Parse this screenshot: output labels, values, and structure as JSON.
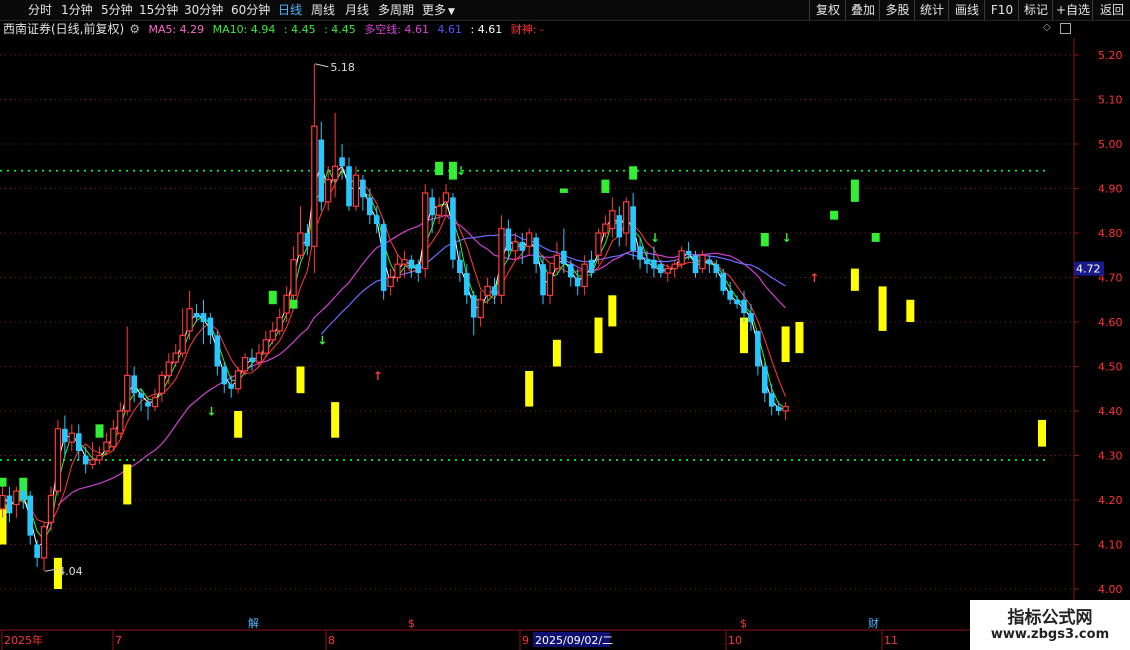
{
  "toolbar": {
    "period_tabs": [
      "分时",
      "1分钟",
      "5分钟",
      "15分钟",
      "30分钟",
      "60分钟",
      "日线",
      "周线",
      "月线",
      "多周期",
      "更多"
    ],
    "active_tab": "日线",
    "right_buttons": [
      "复权",
      "叠加",
      "多股",
      "统计",
      "画线",
      "F10",
      "标记",
      "+自选",
      "返回"
    ]
  },
  "info_bar": {
    "title": "西南证券(日线,前复权)",
    "ma5": "MA5: 4.29",
    "ma10": "MA10: 4.94",
    "v1": ": 4.45",
    "v2": ": 4.45",
    "duokong": "多空线: 4.61",
    "v3": "4.61",
    "v4": ": 4.61",
    "caishen": "财神: -"
  },
  "colors": {
    "up": "#ff3a3a",
    "down": "#29c7ff",
    "yellow": "#ffff00",
    "green": "#33ee33",
    "ma_white": "#ffffff",
    "ma_blue": "#6b6bff",
    "ma_magenta": "#d040d0",
    "grid": "#8b1414",
    "dotted_green": "#00ff44",
    "dotted_magenta": "#ff44ff"
  },
  "chart_data": {
    "type": "candlestick",
    "y_ticks": [
      "5.20",
      "5.10",
      "5.00",
      "4.90",
      "4.80",
      "4.70",
      "4.60",
      "4.50",
      "4.40",
      "4.30",
      "4.20",
      "4.10",
      "4.00"
    ],
    "ylim": [
      3.975,
      5.245
    ],
    "high_label": "5.18",
    "low_label": "4.04",
    "current_price": "4.72",
    "support_level": 4.29,
    "resistance_level": 4.94,
    "x_labels": [
      "2025年",
      "7",
      "8",
      "9",
      "10",
      "11"
    ],
    "date_highlight": "2025/09/02/二",
    "event_markers": [
      "解",
      "$",
      "$",
      "财"
    ],
    "candles": [
      [
        4.18,
        4.21,
        4.16,
        4.23
      ],
      [
        4.21,
        4.17,
        4.15,
        4.23
      ],
      [
        4.19,
        4.22,
        4.16,
        4.23
      ],
      [
        4.22,
        4.2,
        4.18,
        4.24
      ],
      [
        4.21,
        4.12,
        4.1,
        4.22
      ],
      [
        4.1,
        4.07,
        4.05,
        4.11
      ],
      [
        4.07,
        4.14,
        4.04,
        4.15
      ],
      [
        4.15,
        4.21,
        4.13,
        4.23
      ],
      [
        4.22,
        4.36,
        4.21,
        4.38
      ],
      [
        4.36,
        4.33,
        4.3,
        4.39
      ],
      [
        4.33,
        4.35,
        4.31,
        4.37
      ],
      [
        4.35,
        4.31,
        4.29,
        4.37
      ],
      [
        4.3,
        4.28,
        4.26,
        4.32
      ],
      [
        4.28,
        4.29,
        4.27,
        4.33
      ],
      [
        4.29,
        4.3,
        4.28,
        4.32
      ],
      [
        4.31,
        4.33,
        4.3,
        4.35
      ],
      [
        4.32,
        4.36,
        4.31,
        4.38
      ],
      [
        4.35,
        4.4,
        4.34,
        4.42
      ],
      [
        4.4,
        4.48,
        4.39,
        4.59
      ],
      [
        4.48,
        4.44,
        4.42,
        4.5
      ],
      [
        4.44,
        4.43,
        4.4,
        4.45
      ],
      [
        4.42,
        4.41,
        4.38,
        4.43
      ],
      [
        4.41,
        4.43,
        4.4,
        4.45
      ],
      [
        4.44,
        4.48,
        4.42,
        4.49
      ],
      [
        4.48,
        4.51,
        4.46,
        4.53
      ],
      [
        4.51,
        4.53,
        4.5,
        4.55
      ],
      [
        4.53,
        4.57,
        4.52,
        4.63
      ],
      [
        4.58,
        4.63,
        4.56,
        4.67
      ],
      [
        4.62,
        4.61,
        4.6,
        4.64
      ],
      [
        4.62,
        4.6,
        4.55,
        4.65
      ],
      [
        4.61,
        4.57,
        4.55,
        4.62
      ],
      [
        4.57,
        4.5,
        4.48,
        4.58
      ],
      [
        4.5,
        4.46,
        4.44,
        4.51
      ],
      [
        4.46,
        4.45,
        4.43,
        4.48
      ],
      [
        4.45,
        4.49,
        4.44,
        4.5
      ],
      [
        4.49,
        4.52,
        4.48,
        4.53
      ],
      [
        4.52,
        4.51,
        4.49,
        4.54
      ],
      [
        4.51,
        4.53,
        4.5,
        4.55
      ],
      [
        4.53,
        4.56,
        4.52,
        4.58
      ],
      [
        4.56,
        4.58,
        4.55,
        4.6
      ],
      [
        4.58,
        4.61,
        4.57,
        4.63
      ],
      [
        4.62,
        4.66,
        4.6,
        4.68
      ],
      [
        4.66,
        4.74,
        4.65,
        4.77
      ],
      [
        4.75,
        4.8,
        4.74,
        4.86
      ],
      [
        4.8,
        4.77,
        4.75,
        4.82
      ],
      [
        4.77,
        5.04,
        4.71,
        5.18
      ],
      [
        5.01,
        4.87,
        4.85,
        5.05
      ],
      [
        4.87,
        4.92,
        4.85,
        4.95
      ],
      [
        4.92,
        4.95,
        4.88,
        5.07
      ],
      [
        4.97,
        4.95,
        4.92,
        5.0
      ],
      [
        4.95,
        4.86,
        4.85,
        4.97
      ],
      [
        4.86,
        4.93,
        4.85,
        4.95
      ],
      [
        4.92,
        4.88,
        4.85,
        4.93
      ],
      [
        4.88,
        4.84,
        4.82,
        4.9
      ],
      [
        4.84,
        4.82,
        4.8,
        4.86
      ],
      [
        4.82,
        4.67,
        4.65,
        4.83
      ],
      [
        4.68,
        4.7,
        4.66,
        4.72
      ],
      [
        4.7,
        4.73,
        4.69,
        4.75
      ],
      [
        4.73,
        4.74,
        4.7,
        4.76
      ],
      [
        4.74,
        4.72,
        4.7,
        4.75
      ],
      [
        4.73,
        4.71,
        4.69,
        4.74
      ],
      [
        4.72,
        4.89,
        4.7,
        4.91
      ],
      [
        4.88,
        4.84,
        4.8,
        4.9
      ],
      [
        4.84,
        4.86,
        4.82,
        4.88
      ],
      [
        4.87,
        4.89,
        4.84,
        4.91
      ],
      [
        4.88,
        4.74,
        4.72,
        4.89
      ],
      [
        4.74,
        4.71,
        4.69,
        4.76
      ],
      [
        4.71,
        4.66,
        4.64,
        4.73
      ],
      [
        4.66,
        4.61,
        4.57,
        4.67
      ],
      [
        4.61,
        4.65,
        4.59,
        4.67
      ],
      [
        4.66,
        4.68,
        4.64,
        4.7
      ],
      [
        4.68,
        4.66,
        4.64,
        4.7
      ],
      [
        4.66,
        4.81,
        4.64,
        4.84
      ],
      [
        4.81,
        4.76,
        4.74,
        4.83
      ],
      [
        4.76,
        4.78,
        4.74,
        4.8
      ],
      [
        4.78,
        4.76,
        4.73,
        4.8
      ],
      [
        4.77,
        4.8,
        4.75,
        4.81
      ],
      [
        4.79,
        4.73,
        4.71,
        4.8
      ],
      [
        4.73,
        4.66,
        4.64,
        4.75
      ],
      [
        4.66,
        4.71,
        4.64,
        4.73
      ],
      [
        4.72,
        4.75,
        4.71,
        4.78
      ],
      [
        4.76,
        4.73,
        4.71,
        4.81
      ],
      [
        4.73,
        4.7,
        4.68,
        4.74
      ],
      [
        4.7,
        4.68,
        4.66,
        4.72
      ],
      [
        4.68,
        4.73,
        4.66,
        4.75
      ],
      [
        4.74,
        4.71,
        4.7,
        4.76
      ],
      [
        4.75,
        4.8,
        4.73,
        4.81
      ],
      [
        4.8,
        4.82,
        4.79,
        4.84
      ],
      [
        4.81,
        4.85,
        4.79,
        4.88
      ],
      [
        4.84,
        4.79,
        4.77,
        4.86
      ],
      [
        4.8,
        4.87,
        4.77,
        4.88
      ],
      [
        4.86,
        4.76,
        4.74,
        4.89
      ],
      [
        4.77,
        4.74,
        4.72,
        4.79
      ],
      [
        4.74,
        4.73,
        4.71,
        4.76
      ],
      [
        4.74,
        4.72,
        4.7,
        4.77
      ],
      [
        4.73,
        4.71,
        4.7,
        4.74
      ],
      [
        4.71,
        4.72,
        4.69,
        4.73
      ],
      [
        4.72,
        4.73,
        4.7,
        4.74
      ],
      [
        4.73,
        4.76,
        4.72,
        4.77
      ],
      [
        4.76,
        4.75,
        4.74,
        4.78
      ],
      [
        4.75,
        4.71,
        4.7,
        4.76
      ],
      [
        4.72,
        4.75,
        4.71,
        4.76
      ],
      [
        4.74,
        4.73,
        4.71,
        4.75
      ],
      [
        4.73,
        4.71,
        4.7,
        4.74
      ],
      [
        4.71,
        4.67,
        4.66,
        4.72
      ],
      [
        4.67,
        4.65,
        4.64,
        4.69
      ],
      [
        4.65,
        4.64,
        4.63,
        4.66
      ],
      [
        4.65,
        4.62,
        4.6,
        4.67
      ],
      [
        4.62,
        4.6,
        4.58,
        4.64
      ],
      [
        4.58,
        4.5,
        4.48,
        4.58
      ],
      [
        4.5,
        4.44,
        4.42,
        4.51
      ],
      [
        4.44,
        4.41,
        4.39,
        4.46
      ],
      [
        4.41,
        4.4,
        4.39,
        4.42
      ],
      [
        4.4,
        4.41,
        4.38,
        4.42
      ]
    ],
    "yellow_bars": [
      [
        0,
        4.1,
        4.19
      ],
      [
        8,
        4.0,
        4.07
      ],
      [
        18,
        4.19,
        4.28
      ],
      [
        34,
        4.34,
        4.4
      ],
      [
        43,
        4.44,
        4.5
      ],
      [
        48,
        4.34,
        4.42
      ],
      [
        76,
        4.41,
        4.49
      ],
      [
        80,
        4.5,
        4.56
      ],
      [
        86,
        4.53,
        4.61
      ],
      [
        88,
        4.59,
        4.66
      ],
      [
        107,
        4.53,
        4.61
      ],
      [
        113,
        4.51,
        4.59
      ],
      [
        115,
        4.53,
        4.6
      ],
      [
        123,
        4.67,
        4.72
      ],
      [
        127,
        4.58,
        4.68
      ],
      [
        131,
        4.6,
        4.65
      ],
      [
        150,
        4.32,
        4.38
      ]
    ],
    "green_bars": [
      [
        0,
        4.23,
        4.25
      ],
      [
        3,
        4.2,
        4.25
      ],
      [
        14,
        4.34,
        4.37
      ],
      [
        39,
        4.64,
        4.67
      ],
      [
        42,
        4.63,
        4.65
      ],
      [
        63,
        4.93,
        4.96
      ],
      [
        65,
        4.92,
        4.96
      ],
      [
        81,
        4.89,
        4.9
      ],
      [
        87,
        4.89,
        4.92
      ],
      [
        91,
        4.92,
        4.95
      ],
      [
        110,
        4.77,
        4.8
      ],
      [
        120,
        4.83,
        4.85
      ],
      [
        123,
        4.87,
        4.92
      ],
      [
        126,
        4.78,
        4.8
      ]
    ]
  }
}
